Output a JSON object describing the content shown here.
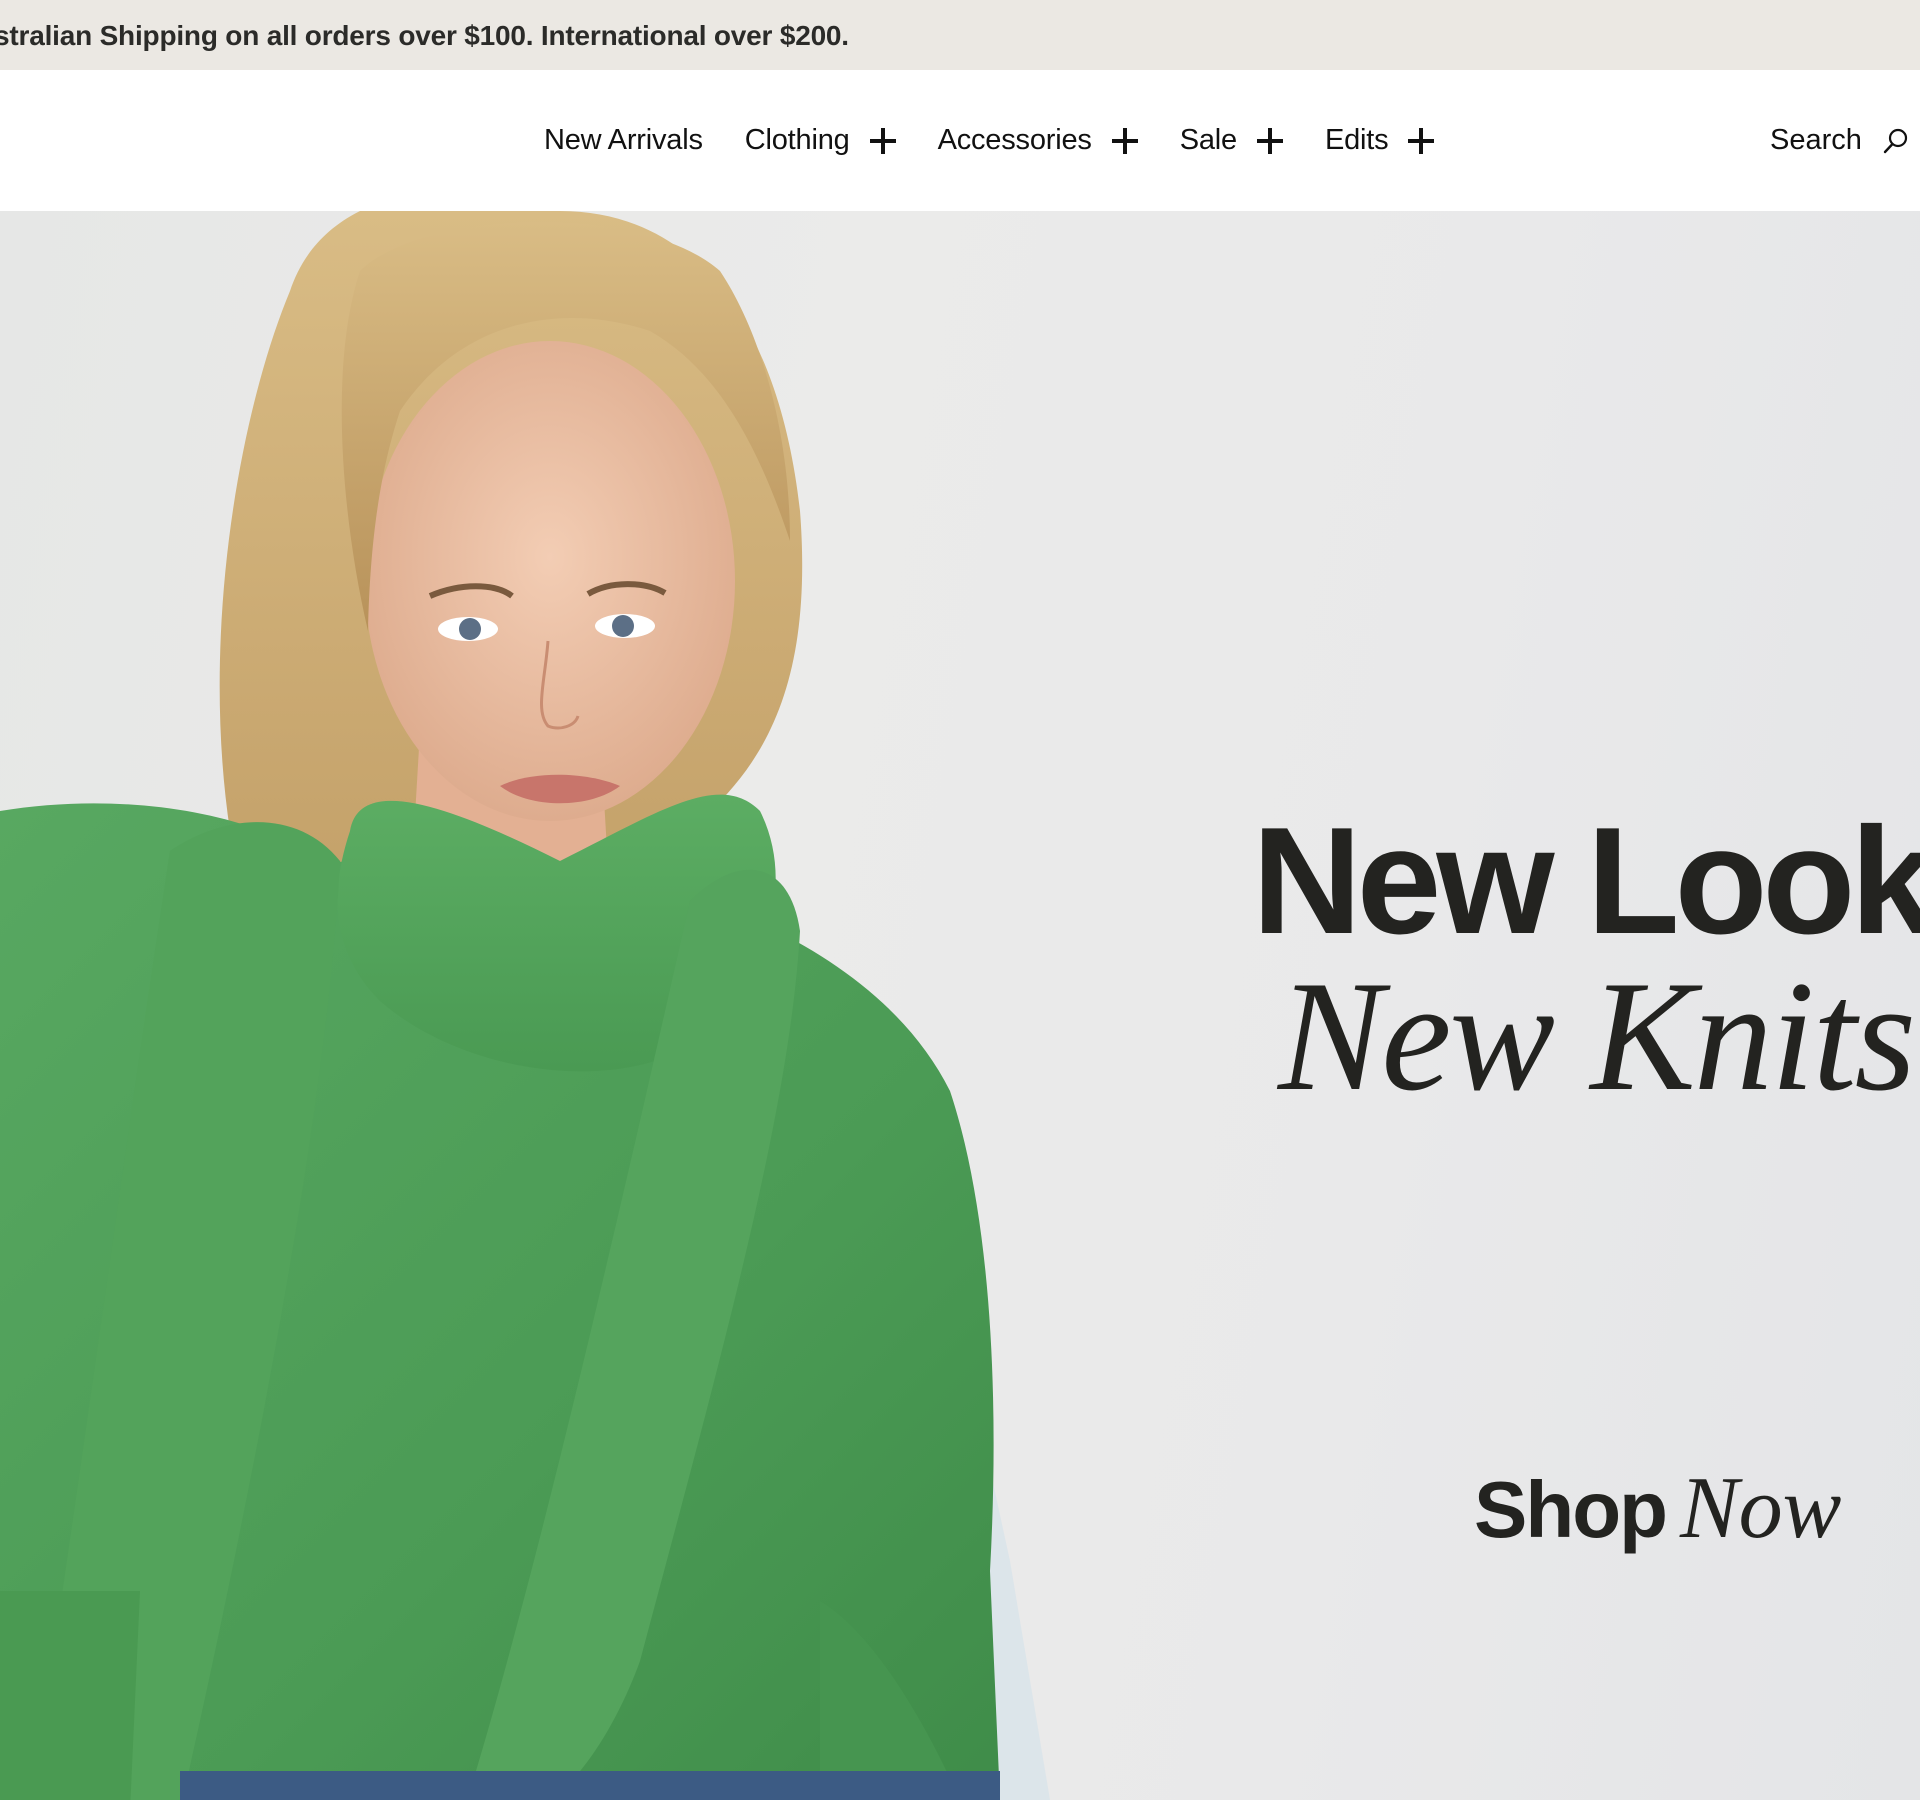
{
  "announcement": {
    "text": "stralian Shipping on all orders over $100. International over $200."
  },
  "nav": {
    "items": [
      {
        "label": "New Arrivals",
        "expandable": false
      },
      {
        "label": "Clothing",
        "expandable": true
      },
      {
        "label": "Accessories",
        "expandable": true
      },
      {
        "label": "Sale",
        "expandable": true
      },
      {
        "label": "Edits",
        "expandable": true
      }
    ],
    "search_label": "Search"
  },
  "hero": {
    "headline_line1": "New Look",
    "headline_line2": "New Knits",
    "cta_primary": "Shop",
    "cta_secondary": "Now",
    "image_description_colors": {
      "sweater": "#4f9e57",
      "scarf": "#56a55c",
      "background": "#e8e8e8",
      "hair": "#c9a76a"
    }
  },
  "colors": {
    "announcement_bg": "#ebe8e3",
    "text_dark": "#232320",
    "header_bg": "#ffffff"
  }
}
